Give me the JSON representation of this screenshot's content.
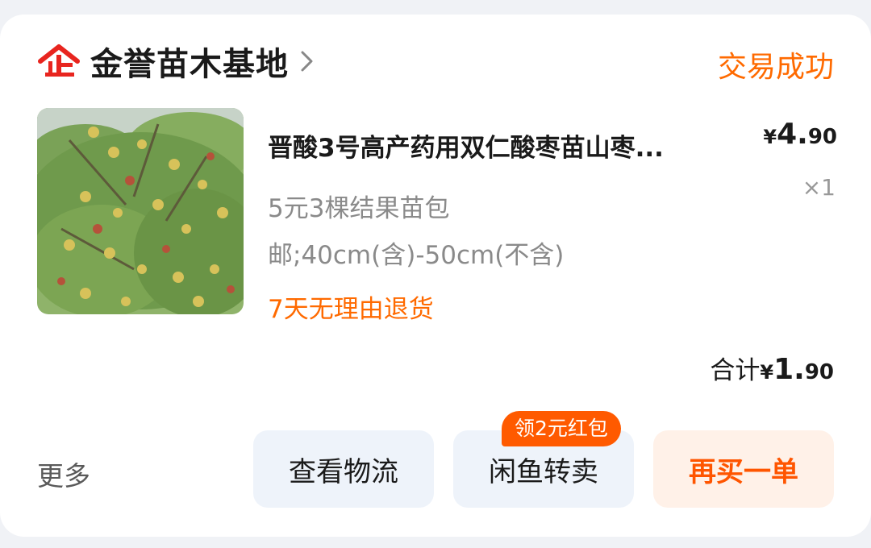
{
  "shop": {
    "name": "金誉苗木基地",
    "icon": "enterprise-icon"
  },
  "order": {
    "status": "交易成功"
  },
  "product": {
    "title": "晋酸3号高产药用双仁酸枣苗山枣...",
    "spec_line1": "5元3棵结果苗包",
    "spec_line2": "邮;40cm(含)-50cm(不含)",
    "refund_tag": "7天无理由退货",
    "price_symbol": "¥",
    "price_int": "4.",
    "price_dec": "90",
    "quantity": "×1",
    "image": "jujube-tree-photo"
  },
  "total": {
    "label": "合计",
    "symbol": "¥",
    "int": "1.",
    "dec": "90"
  },
  "actions": {
    "more": "更多",
    "logistics": "查看物流",
    "resell": "闲鱼转卖",
    "resell_badge": "领2元红包",
    "rebuy": "再买一单"
  },
  "colors": {
    "accent": "#ff6a00",
    "icon_red": "#e8251f",
    "button_bg": "#eef3fa",
    "rebuy_bg": "#fff1e8"
  }
}
